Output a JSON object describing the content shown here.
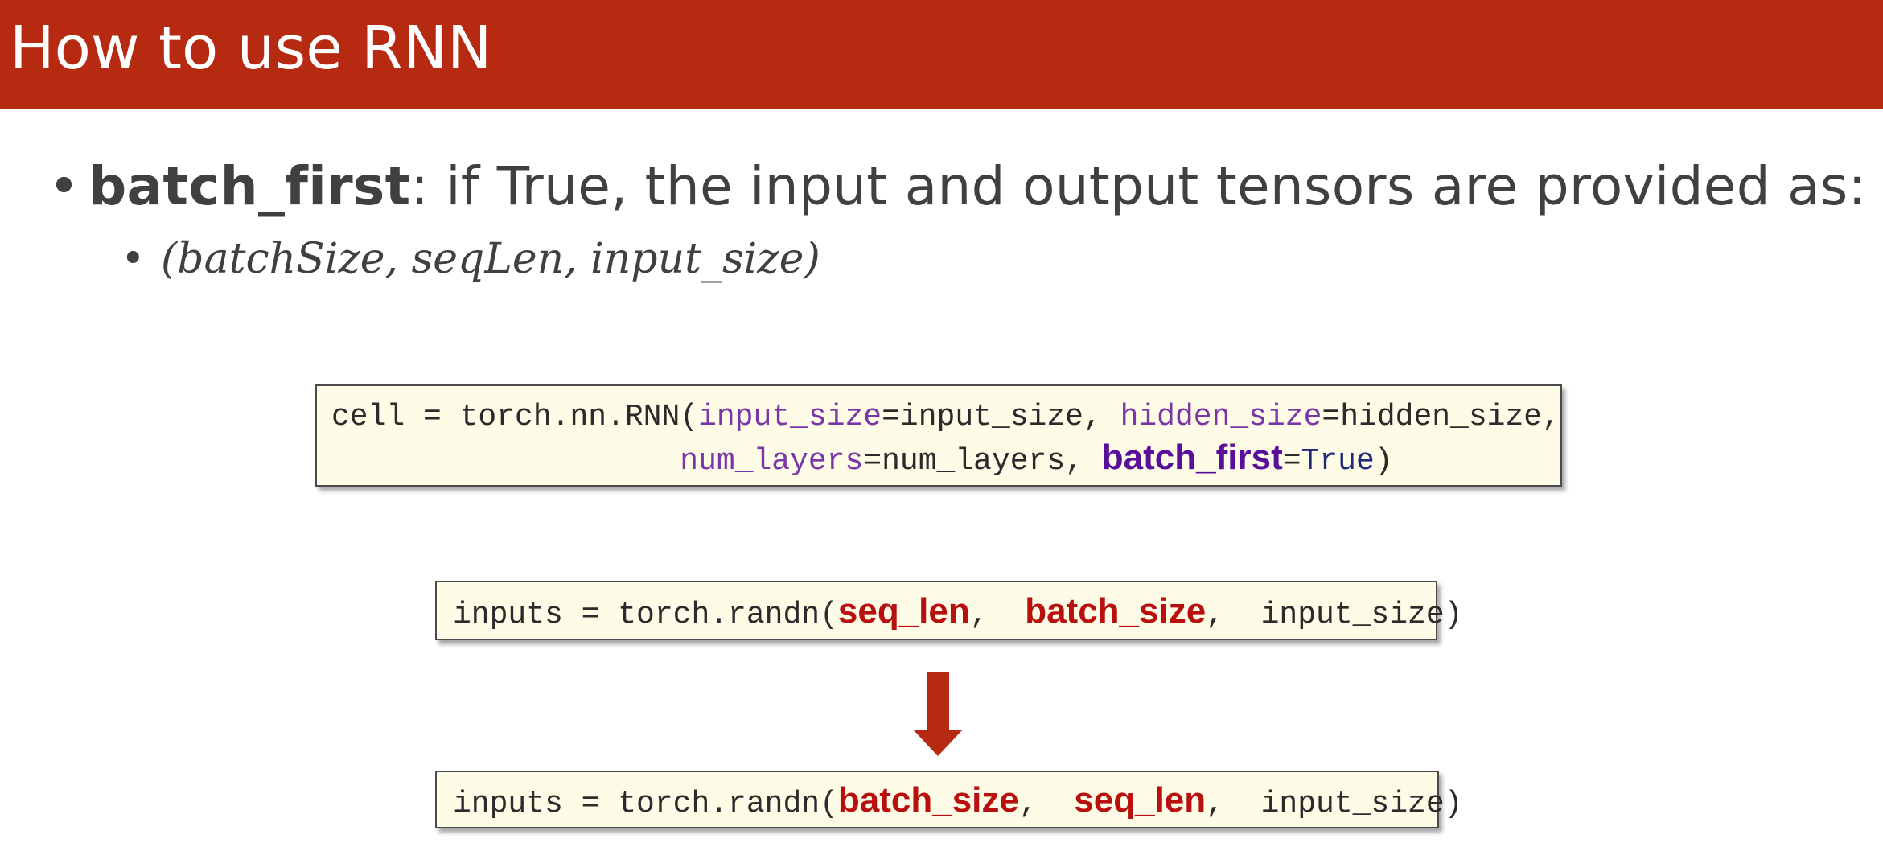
{
  "slide": {
    "title": "How to use RNN",
    "bullet1": {
      "term": "batch_first",
      "text": ": if True, the input and output tensors are provided as:"
    },
    "bullet2": {
      "math": "(batchSize, seqLen, input_size)"
    }
  },
  "code_cell": {
    "l1_a": "cell = torch.nn.RNN(",
    "l1_kw1": "input_size",
    "l1_b": "=input_size, ",
    "l1_kw2": "hidden_size",
    "l1_c": "=hidden_size,",
    "l2_indent": "                   ",
    "l2_kw1": "num_layers",
    "l2_a": "=num_layers, ",
    "l2_kw2": "batch_first",
    "l2_b": "=",
    "l2_val": "True",
    "l2_c": ")"
  },
  "code_before": {
    "a": "inputs = torch.randn(",
    "arg1": "seq_len",
    "sep1": ",  ",
    "arg2": "batch_size",
    "sep2": ",  ",
    "rest": "input_size)"
  },
  "code_after": {
    "a": "inputs = torch.randn(",
    "arg1": "batch_size",
    "sep1": ",  ",
    "arg2": "seq_len",
    "sep2": ",  ",
    "rest": "input_size)"
  },
  "colors": {
    "title_bg": "#b72a12",
    "arrow": "#b72a12",
    "highlight_red": "#b80f0f",
    "highlight_purple": "#5a0f9a"
  },
  "icons": {
    "arrow": "down-arrow-icon"
  }
}
